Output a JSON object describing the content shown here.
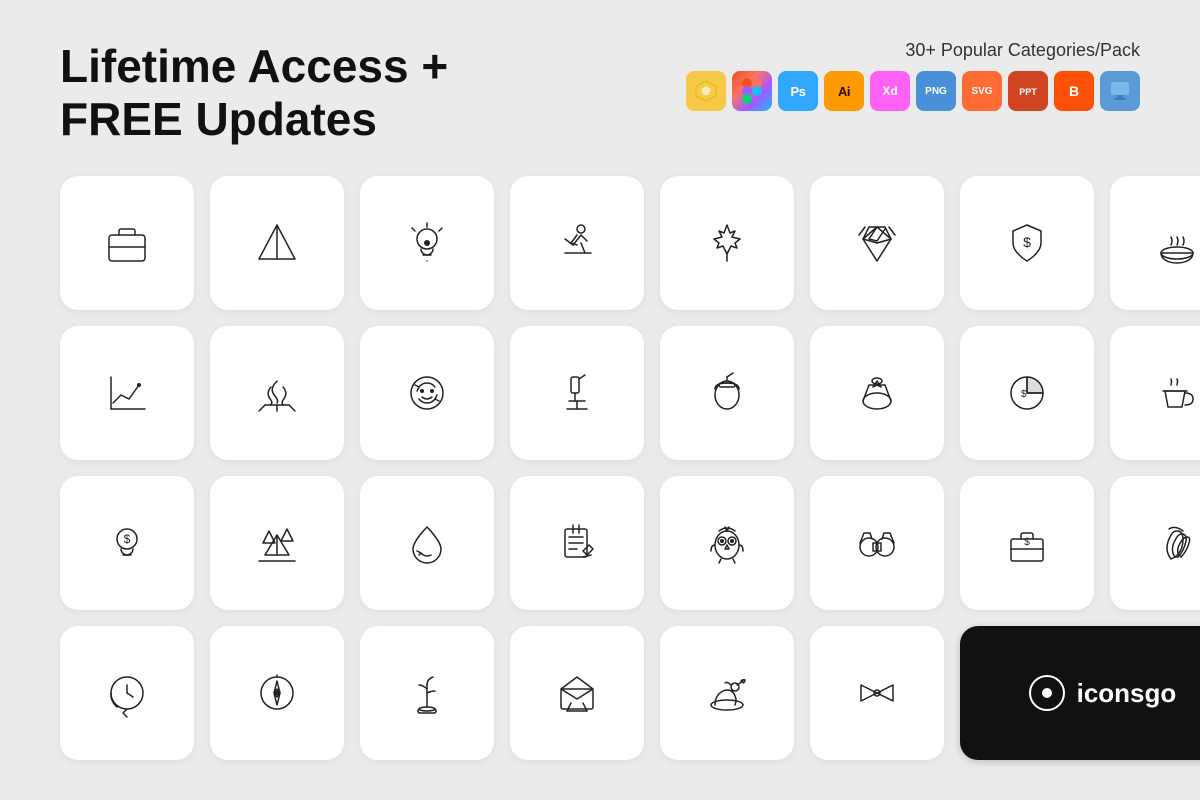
{
  "header": {
    "title_line1": "Lifetime Access +",
    "title_line2": "FREE Updates",
    "categories_label": "30+ Popular Categories/Pack"
  },
  "formats": [
    {
      "label": "Sk",
      "class": "badge-sketch"
    },
    {
      "label": "Fig",
      "class": "badge-figma"
    },
    {
      "label": "Ps",
      "class": "badge-ps"
    },
    {
      "label": "Ai",
      "class": "badge-ai"
    },
    {
      "label": "Xd",
      "class": "badge-xd"
    },
    {
      "label": "PNG",
      "class": "badge-png"
    },
    {
      "label": "SVG",
      "class": "badge-svg"
    },
    {
      "label": "Ppt",
      "class": "badge-ppt"
    },
    {
      "label": "B",
      "class": "badge-blogger"
    },
    {
      "label": "Kn",
      "class": "badge-keynote"
    }
  ],
  "logo": {
    "text": "iconsgo"
  }
}
